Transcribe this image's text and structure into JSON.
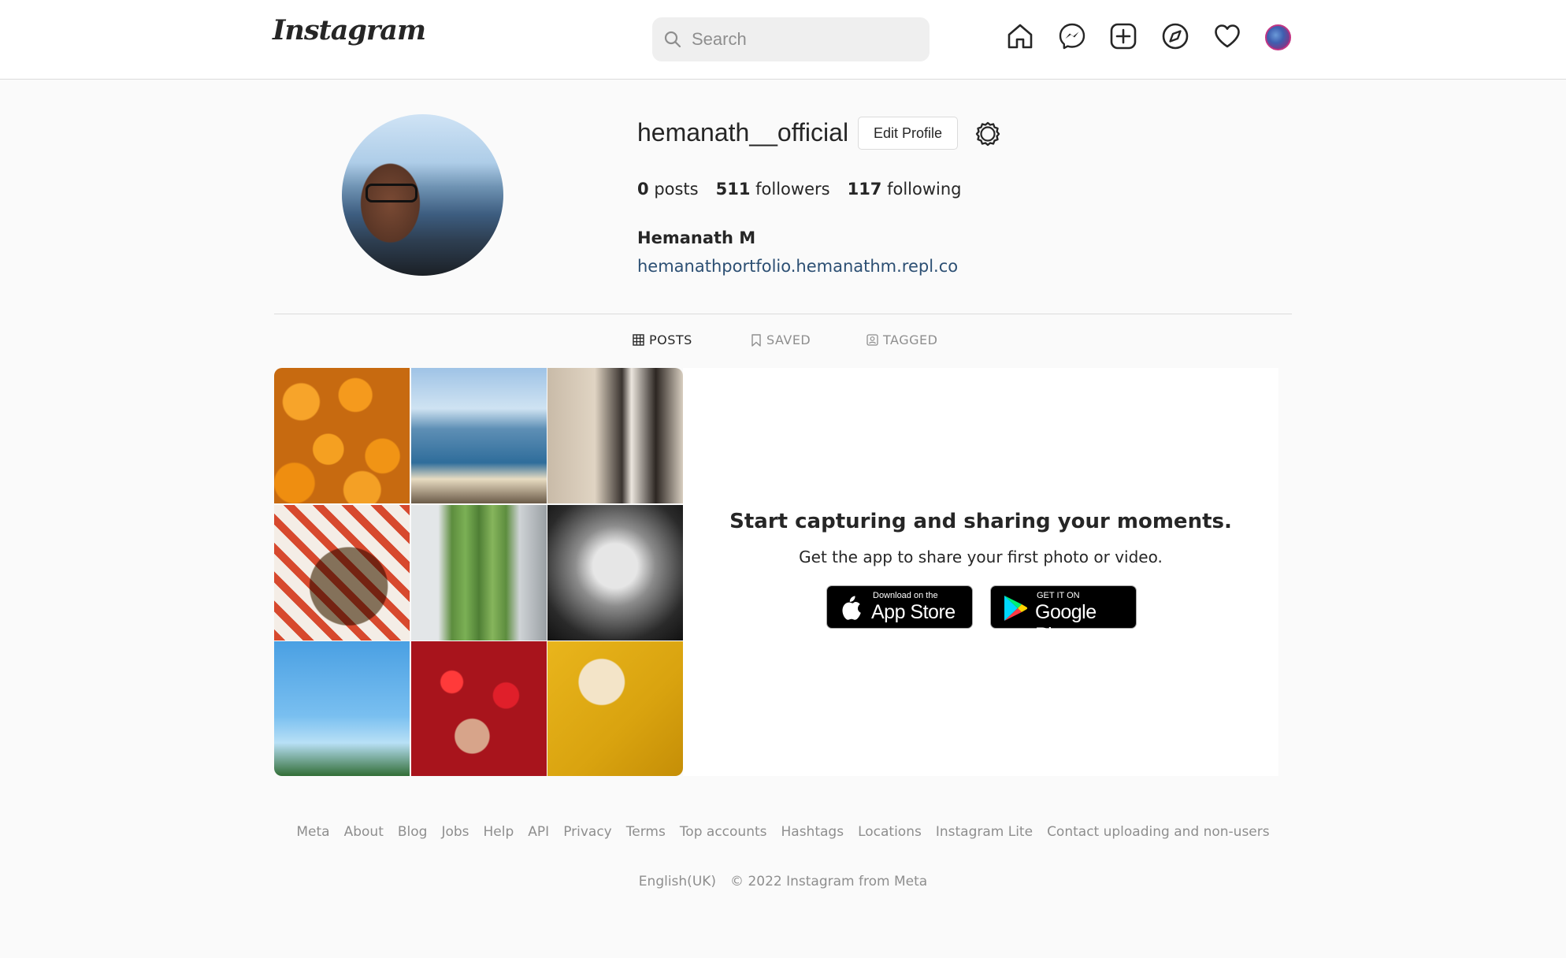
{
  "nav": {
    "logo": "Instagram",
    "search_placeholder": "Search",
    "icons": [
      "home-icon",
      "messenger-icon",
      "new-post-icon",
      "explore-icon",
      "activity-heart-icon",
      "profile-avatar"
    ]
  },
  "profile": {
    "username": "hemanath__official",
    "edit_button": "Edit Profile",
    "stats": {
      "posts_count": "0",
      "posts_label": "posts",
      "followers_count": "511",
      "followers_label": "followers",
      "following_count": "117",
      "following_label": "following"
    },
    "full_name": "Hemanath M",
    "website": "hemanathportfolio.hemanathm.repl.co"
  },
  "tabs": [
    {
      "label": "POSTS",
      "active": true
    },
    {
      "label": "SAVED",
      "active": false
    },
    {
      "label": "TAGGED",
      "active": false
    }
  ],
  "empty_state": {
    "title": "Start capturing and sharing your moments.",
    "subtitle": "Get the app to share your first photo or video.",
    "app_store": {
      "small": "Download on the",
      "big": "App Store"
    },
    "google_play": {
      "small": "GET IT ON",
      "big": "Google Play"
    }
  },
  "footer": {
    "links": [
      "Meta",
      "About",
      "Blog",
      "Jobs",
      "Help",
      "API",
      "Privacy",
      "Terms",
      "Top accounts",
      "Hashtags",
      "Locations",
      "Instagram Lite",
      "Contact uploading and non-users"
    ],
    "language": "English(UK)",
    "copyright": "© 2022 Instagram from Meta"
  },
  "colors": {
    "link": "#2c4f73",
    "border": "#dbdbdb",
    "background": "#fafafa"
  }
}
